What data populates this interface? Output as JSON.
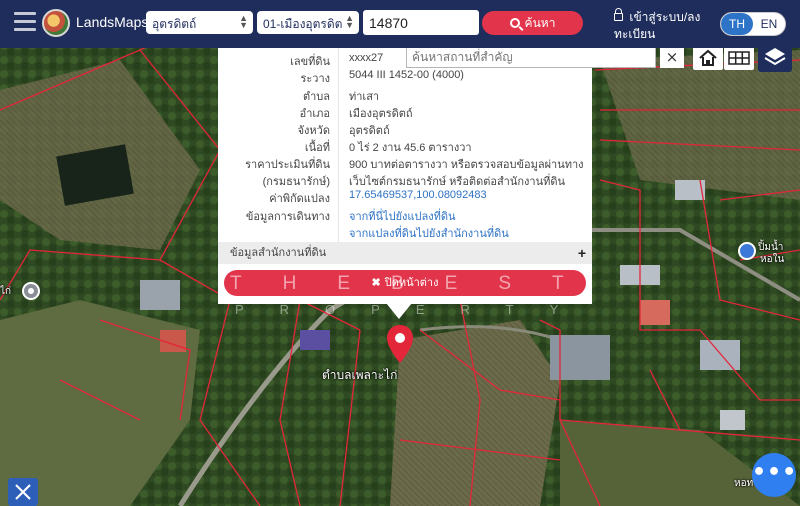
{
  "app": {
    "brand": "LandsMaps"
  },
  "header": {
    "province_select": "อุตรดิตถ์",
    "district_select": "01-เมืองอุตรดิต",
    "search_value": "14870",
    "search_button": "ค้นหา",
    "login_label": "เข้าสู่ระบบ/ลงทะเบียน",
    "lang_th": "TH",
    "lang_en": "EN",
    "active_lang": "TH"
  },
  "map_controls": {
    "place_search_placeholder": "ค้นหาสถานที่สำคัญ",
    "place_close": "×"
  },
  "parcel_info": {
    "rows": [
      {
        "label": "เลขที่ดิน",
        "value": "xxxx27",
        "link": false
      },
      {
        "label": "ระวาง",
        "value": "5044 III 1452-00 (4000)",
        "link": false
      },
      {
        "label": "ตำบล",
        "value": "ท่าเสา",
        "link": false
      },
      {
        "label": "อำเภอ",
        "value": "เมืองอุตรดิตถ์",
        "link": false
      },
      {
        "label": "จังหวัด",
        "value": "อุตรดิตถ์",
        "link": false
      },
      {
        "label": "เนื้อที่",
        "value": "0 ไร่ 2 งาน 45.6 ตารางวา",
        "link": false
      },
      {
        "label": "ราคาประเมินที่ดิน",
        "value": "900 บาทต่อตารางวา หรือตรวจสอบข้อมูลผ่านทาง",
        "link": false
      },
      {
        "label": "(กรมธนารักษ์)",
        "value": "เว็บไซต์กรมธนารักษ์ หรือติดต่อสำนักงานที่ดิน",
        "link": false
      },
      {
        "label": "ค่าพิกัดแปลง",
        "value": "17.65469537,100.08092483",
        "link": true
      },
      {
        "label": "ข้อมูลการเดินทาง",
        "value": "จากที่นี่ไปยังแปลงที่ดิน",
        "link": true
      },
      {
        "label": "",
        "value": "จากแปลงที่ดินไปยังสำนักงานที่ดิน",
        "link": true
      }
    ],
    "office_section": "ข้อมูลสำนักงานที่ดิน",
    "office_toggle": "+",
    "close_button": "ปิดหน้าต่าง"
  },
  "watermark": {
    "line1": "THEBEST",
    "line2": "PROPERTY"
  },
  "map_labels": {
    "parcel_label": "ตำบลเพลาะไก่",
    "poi_left": "ไก่",
    "poi_right_1": "ปิ้มน้ำ",
    "poi_right_2": "หอใน",
    "poi_bottom_right": "หอท"
  },
  "fab_label": "•••",
  "colors": {
    "header_bg": "#1f2d5c",
    "accent_red": "#e2344a",
    "link_blue": "#2e72c4",
    "lang_active": "#2d73c7",
    "fab_blue": "#2f7ff0",
    "parcel_line": "#e3263a"
  },
  "icons": {
    "menu": "hamburger-icon",
    "search": "search-icon",
    "lock": "lock-icon",
    "home": "home-icon",
    "grid": "grid-icon",
    "layers": "layers-icon",
    "marker": "map-pin-icon",
    "measure": "measure-icon",
    "more": "more-icon"
  }
}
